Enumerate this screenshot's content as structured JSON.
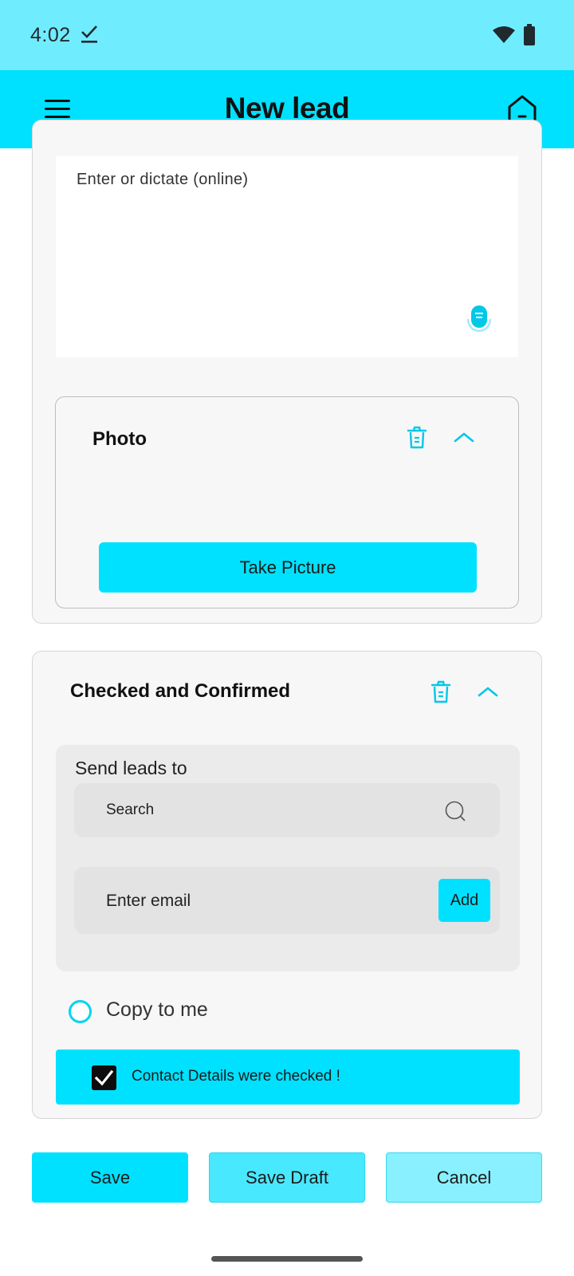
{
  "status_bar": {
    "time": "4:02"
  },
  "app_bar": {
    "title": "New lead",
    "menu_icon": "hamburger-menu-icon",
    "home_icon": "home-icon"
  },
  "notes": {
    "placeholder": "Enter or dictate (online)",
    "mic_icon": "microphone-icon"
  },
  "photo": {
    "title": "Photo",
    "take_picture_label": "Take Picture"
  },
  "checked": {
    "title": "Checked and Confirmed",
    "send_label": "Send leads to",
    "search_placeholder": "Search",
    "email_placeholder": "Enter email",
    "add_label": "Add",
    "copy_label": "Copy to me",
    "copy_selected": false,
    "contact_label": "Contact Details were checked !",
    "contact_checked": true
  },
  "buttons": {
    "save": "Save",
    "save_draft": "Save Draft",
    "cancel": "Cancel"
  },
  "colors": {
    "accent": "#00e1ff",
    "status_bar": "#70ecff",
    "card_bg": "#f7f7f7"
  }
}
